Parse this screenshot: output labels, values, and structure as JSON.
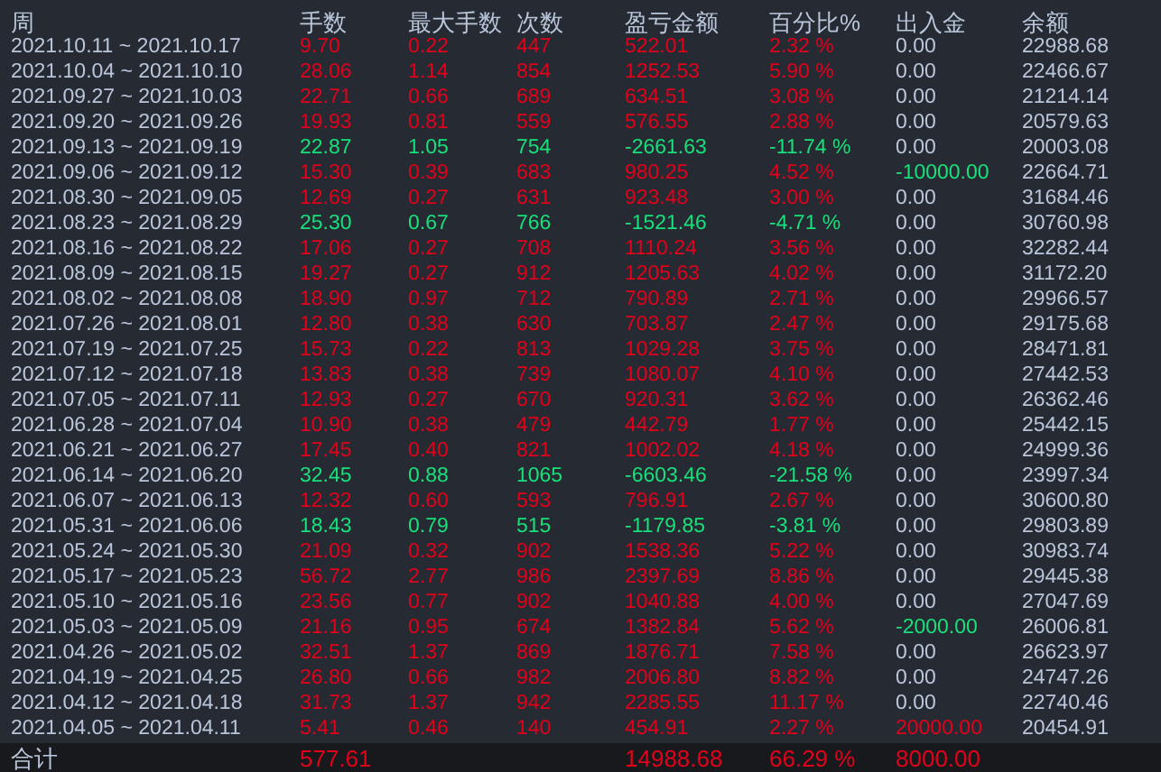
{
  "table": {
    "columns": [
      "周",
      "手数",
      "最大手数",
      "次数",
      "盈亏金额",
      "百分比%",
      "出入金",
      "余额"
    ],
    "rows": [
      {
        "week": "2021.10.11 ~ 2021.10.17",
        "lots": "9.70",
        "max_lots": "0.22",
        "count": "447",
        "pnl": "522.01",
        "percent": "2.32 %",
        "transfer": {
          "text": "0.00",
          "color": "#b9c6da"
        },
        "balance": "22988.68",
        "color": "#e3001b"
      },
      {
        "week": "2021.10.04 ~ 2021.10.10",
        "lots": "28.06",
        "max_lots": "1.14",
        "count": "854",
        "pnl": "1252.53",
        "percent": "5.90 %",
        "transfer": {
          "text": "0.00",
          "color": "#b9c6da"
        },
        "balance": "22466.67",
        "color": "#e3001b"
      },
      {
        "week": "2021.09.27 ~ 2021.10.03",
        "lots": "22.71",
        "max_lots": "0.66",
        "count": "689",
        "pnl": "634.51",
        "percent": "3.08 %",
        "transfer": {
          "text": "0.00",
          "color": "#b9c6da"
        },
        "balance": "21214.14",
        "color": "#e3001b"
      },
      {
        "week": "2021.09.20 ~ 2021.09.26",
        "lots": "19.93",
        "max_lots": "0.81",
        "count": "559",
        "pnl": "576.55",
        "percent": "2.88 %",
        "transfer": {
          "text": "0.00",
          "color": "#b9c6da"
        },
        "balance": "20579.63",
        "color": "#e3001b"
      },
      {
        "week": "2021.09.13 ~ 2021.09.19",
        "lots": "22.87",
        "max_lots": "1.05",
        "count": "754",
        "pnl": "-2661.63",
        "percent": "-11.74 %",
        "transfer": {
          "text": "0.00",
          "color": "#b9c6da"
        },
        "balance": "20003.08",
        "color": "#18e07a"
      },
      {
        "week": "2021.09.06 ~ 2021.09.12",
        "lots": "15.30",
        "max_lots": "0.39",
        "count": "683",
        "pnl": "980.25",
        "percent": "4.52 %",
        "transfer": {
          "text": "-10000.00",
          "color": "#18e07a"
        },
        "balance": "22664.71",
        "color": "#e3001b"
      },
      {
        "week": "2021.08.30 ~ 2021.09.05",
        "lots": "12.69",
        "max_lots": "0.27",
        "count": "631",
        "pnl": "923.48",
        "percent": "3.00 %",
        "transfer": {
          "text": "0.00",
          "color": "#b9c6da"
        },
        "balance": "31684.46",
        "color": "#e3001b"
      },
      {
        "week": "2021.08.23 ~ 2021.08.29",
        "lots": "25.30",
        "max_lots": "0.67",
        "count": "766",
        "pnl": "-1521.46",
        "percent": "-4.71 %",
        "transfer": {
          "text": "0.00",
          "color": "#b9c6da"
        },
        "balance": "30760.98",
        "color": "#18e07a"
      },
      {
        "week": "2021.08.16 ~ 2021.08.22",
        "lots": "17.06",
        "max_lots": "0.27",
        "count": "708",
        "pnl": "1110.24",
        "percent": "3.56 %",
        "transfer": {
          "text": "0.00",
          "color": "#b9c6da"
        },
        "balance": "32282.44",
        "color": "#e3001b"
      },
      {
        "week": "2021.08.09 ~ 2021.08.15",
        "lots": "19.27",
        "max_lots": "0.27",
        "count": "912",
        "pnl": "1205.63",
        "percent": "4.02 %",
        "transfer": {
          "text": "0.00",
          "color": "#b9c6da"
        },
        "balance": "31172.20",
        "color": "#e3001b"
      },
      {
        "week": "2021.08.02 ~ 2021.08.08",
        "lots": "18.90",
        "max_lots": "0.97",
        "count": "712",
        "pnl": "790.89",
        "percent": "2.71 %",
        "transfer": {
          "text": "0.00",
          "color": "#b9c6da"
        },
        "balance": "29966.57",
        "color": "#e3001b"
      },
      {
        "week": "2021.07.26 ~ 2021.08.01",
        "lots": "12.80",
        "max_lots": "0.38",
        "count": "630",
        "pnl": "703.87",
        "percent": "2.47 %",
        "transfer": {
          "text": "0.00",
          "color": "#b9c6da"
        },
        "balance": "29175.68",
        "color": "#e3001b"
      },
      {
        "week": "2021.07.19 ~ 2021.07.25",
        "lots": "15.73",
        "max_lots": "0.22",
        "count": "813",
        "pnl": "1029.28",
        "percent": "3.75 %",
        "transfer": {
          "text": "0.00",
          "color": "#b9c6da"
        },
        "balance": "28471.81",
        "color": "#e3001b"
      },
      {
        "week": "2021.07.12 ~ 2021.07.18",
        "lots": "13.83",
        "max_lots": "0.38",
        "count": "739",
        "pnl": "1080.07",
        "percent": "4.10 %",
        "transfer": {
          "text": "0.00",
          "color": "#b9c6da"
        },
        "balance": "27442.53",
        "color": "#e3001b"
      },
      {
        "week": "2021.07.05 ~ 2021.07.11",
        "lots": "12.93",
        "max_lots": "0.27",
        "count": "670",
        "pnl": "920.31",
        "percent": "3.62 %",
        "transfer": {
          "text": "0.00",
          "color": "#b9c6da"
        },
        "balance": "26362.46",
        "color": "#e3001b"
      },
      {
        "week": "2021.06.28 ~ 2021.07.04",
        "lots": "10.90",
        "max_lots": "0.38",
        "count": "479",
        "pnl": "442.79",
        "percent": "1.77 %",
        "transfer": {
          "text": "0.00",
          "color": "#b9c6da"
        },
        "balance": "25442.15",
        "color": "#e3001b"
      },
      {
        "week": "2021.06.21 ~ 2021.06.27",
        "lots": "17.45",
        "max_lots": "0.40",
        "count": "821",
        "pnl": "1002.02",
        "percent": "4.18 %",
        "transfer": {
          "text": "0.00",
          "color": "#b9c6da"
        },
        "balance": "24999.36",
        "color": "#e3001b"
      },
      {
        "week": "2021.06.14 ~ 2021.06.20",
        "lots": "32.45",
        "max_lots": "0.88",
        "count": "1065",
        "pnl": "-6603.46",
        "percent": "-21.58 %",
        "transfer": {
          "text": "0.00",
          "color": "#b9c6da"
        },
        "balance": "23997.34",
        "color": "#18e07a"
      },
      {
        "week": "2021.06.07 ~ 2021.06.13",
        "lots": "12.32",
        "max_lots": "0.60",
        "count": "593",
        "pnl": "796.91",
        "percent": "2.67 %",
        "transfer": {
          "text": "0.00",
          "color": "#b9c6da"
        },
        "balance": "30600.80",
        "color": "#e3001b"
      },
      {
        "week": "2021.05.31 ~ 2021.06.06",
        "lots": "18.43",
        "max_lots": "0.79",
        "count": "515",
        "pnl": "-1179.85",
        "percent": "-3.81 %",
        "transfer": {
          "text": "0.00",
          "color": "#b9c6da"
        },
        "balance": "29803.89",
        "color": "#18e07a"
      },
      {
        "week": "2021.05.24 ~ 2021.05.30",
        "lots": "21.09",
        "max_lots": "0.32",
        "count": "902",
        "pnl": "1538.36",
        "percent": "5.22 %",
        "transfer": {
          "text": "0.00",
          "color": "#b9c6da"
        },
        "balance": "30983.74",
        "color": "#e3001b"
      },
      {
        "week": "2021.05.17 ~ 2021.05.23",
        "lots": "56.72",
        "max_lots": "2.77",
        "count": "986",
        "pnl": "2397.69",
        "percent": "8.86 %",
        "transfer": {
          "text": "0.00",
          "color": "#b9c6da"
        },
        "balance": "29445.38",
        "color": "#e3001b"
      },
      {
        "week": "2021.05.10 ~ 2021.05.16",
        "lots": "23.56",
        "max_lots": "0.77",
        "count": "902",
        "pnl": "1040.88",
        "percent": "4.00 %",
        "transfer": {
          "text": "0.00",
          "color": "#b9c6da"
        },
        "balance": "27047.69",
        "color": "#e3001b"
      },
      {
        "week": "2021.05.03 ~ 2021.05.09",
        "lots": "21.16",
        "max_lots": "0.95",
        "count": "674",
        "pnl": "1382.84",
        "percent": "5.62 %",
        "transfer": {
          "text": "-2000.00",
          "color": "#18e07a"
        },
        "balance": "26006.81",
        "color": "#e3001b"
      },
      {
        "week": "2021.04.26 ~ 2021.05.02",
        "lots": "32.51",
        "max_lots": "1.37",
        "count": "869",
        "pnl": "1876.71",
        "percent": "7.58 %",
        "transfer": {
          "text": "0.00",
          "color": "#b9c6da"
        },
        "balance": "26623.97",
        "color": "#e3001b"
      },
      {
        "week": "2021.04.19 ~ 2021.04.25",
        "lots": "26.80",
        "max_lots": "0.66",
        "count": "982",
        "pnl": "2006.80",
        "percent": "8.82 %",
        "transfer": {
          "text": "0.00",
          "color": "#b9c6da"
        },
        "balance": "24747.26",
        "color": "#e3001b"
      },
      {
        "week": "2021.04.12 ~ 2021.04.18",
        "lots": "31.73",
        "max_lots": "1.37",
        "count": "942",
        "pnl": "2285.55",
        "percent": "11.17 %",
        "transfer": {
          "text": "0.00",
          "color": "#b9c6da"
        },
        "balance": "22740.46",
        "color": "#e3001b"
      },
      {
        "week": "2021.04.05 ~ 2021.04.11",
        "lots": "5.41",
        "max_lots": "0.46",
        "count": "140",
        "pnl": "454.91",
        "percent": "2.27 %",
        "transfer": {
          "text": "20000.00",
          "color": "#e3001b"
        },
        "balance": "20454.91",
        "color": "#e3001b"
      }
    ],
    "total": {
      "label": "合计",
      "lots": "577.61",
      "pnl": "14988.68",
      "percent": "66.29 %",
      "transfer": {
        "text": "8000.00",
        "color": "#e3001b"
      },
      "color": "#e3001b"
    }
  }
}
